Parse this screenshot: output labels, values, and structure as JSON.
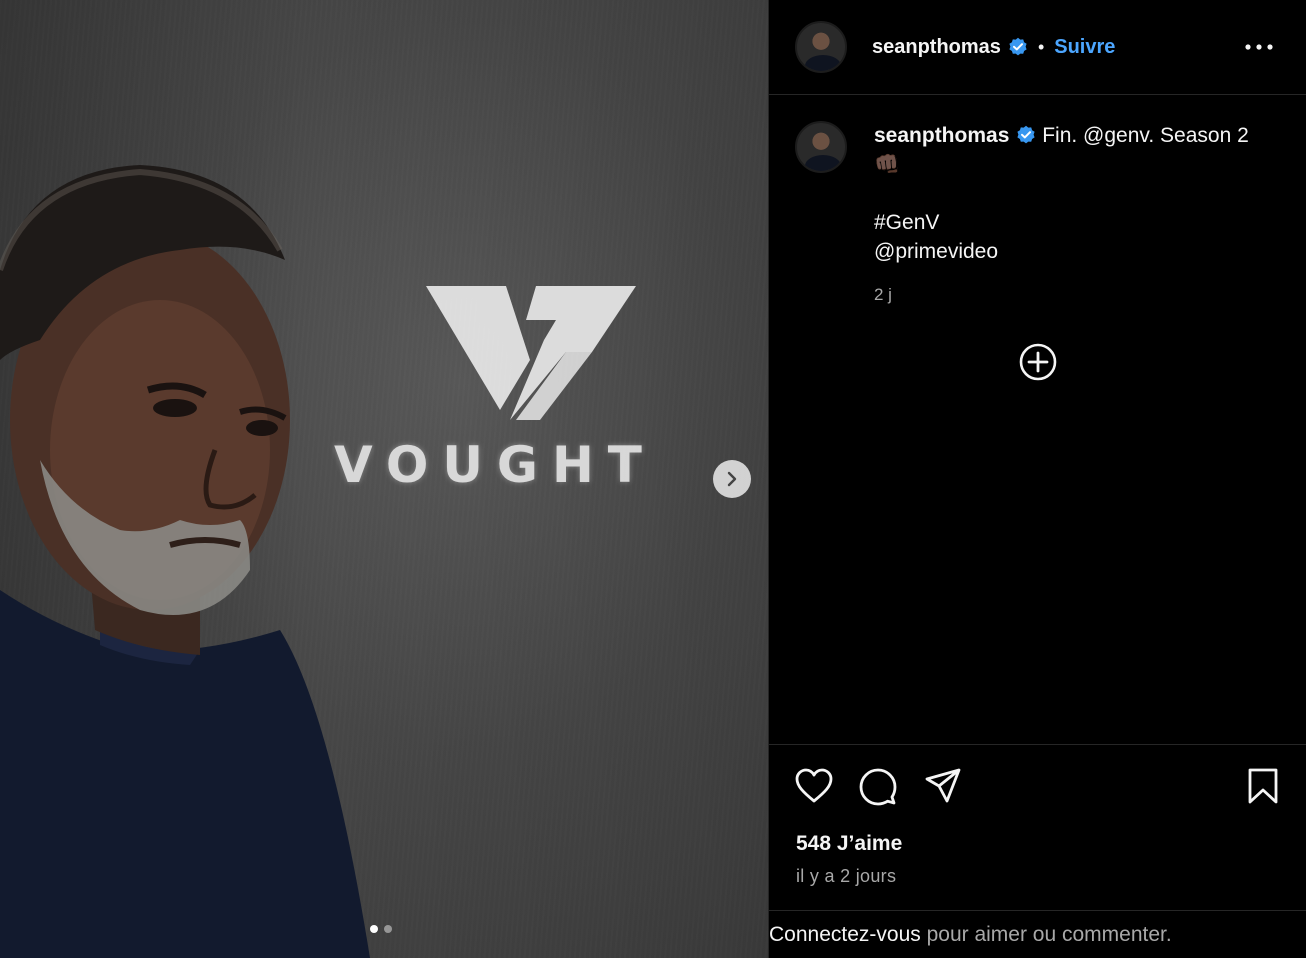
{
  "post": {
    "image": {
      "wall_text": "VOUGHT",
      "carousel_total": 2,
      "carousel_current": 1
    },
    "author": {
      "username": "seanpthomas",
      "verified": true,
      "separator": "•",
      "follow_label": "Suivre"
    },
    "caption": {
      "username": "seanpthomas",
      "line1": "Fin. @genv. Season 2👊🏿",
      "line2": "#GenV",
      "line3": "@primevideo",
      "time": "2 j"
    },
    "stats": {
      "likes": "548 J’aime",
      "date": "il y a 2 jours"
    },
    "login_prompt": {
      "link": "Connectez-vous",
      "rest": " pour aimer ou commenter."
    },
    "colors": {
      "background": "#000000",
      "accent": "#4ca6ff",
      "verified": "#3897f0",
      "muted_text": "#a8a8a8"
    },
    "icons": [
      "verified-icon",
      "more-options-icon",
      "add-comment-icon",
      "heart-icon",
      "comment-icon",
      "share-icon",
      "bookmark-icon",
      "chevron-right-icon"
    ]
  }
}
